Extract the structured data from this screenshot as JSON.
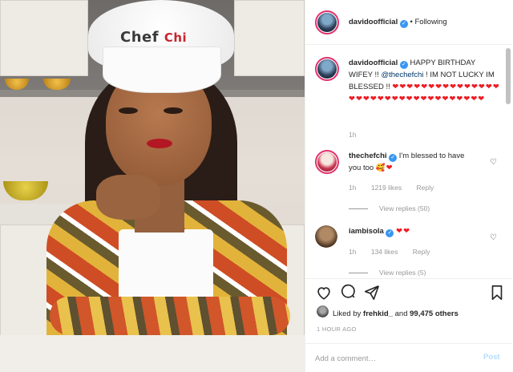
{
  "post": {
    "author": "davidoofficial",
    "follow_status": "Following",
    "separator": "•"
  },
  "caption": {
    "username": "davidoofficial",
    "text_before": "HAPPY BIRTHDAY WIFEY !! ",
    "mention": "@thechefchi",
    "text_after": " ! IM NOT LUCKY IM BLESSED !! ",
    "hearts": "❤❤❤❤❤❤❤❤❤❤❤❤❤❤❤❤❤❤❤❤❤❤❤❤❤❤❤❤❤❤❤❤❤❤",
    "age": "1h"
  },
  "comments": [
    {
      "username": "thechefchi",
      "text": "I'm blessed to have you too ",
      "emoji": "🥰❤",
      "age": "1h",
      "likes": "1219 likes",
      "reply": "Reply",
      "view_replies": "View replies (50)"
    },
    {
      "username": "iambisola",
      "text": "",
      "emoji": "❤❤",
      "age": "1h",
      "likes": "134 likes",
      "reply": "Reply",
      "view_replies": "View replies (5)"
    }
  ],
  "photo": {
    "hat_text_main": "Chef",
    "hat_text_accent": "Chi"
  },
  "engagement": {
    "liked_prefix": "Liked by ",
    "liked_user": "frehkid_",
    "liked_suffix": " and ",
    "others": "99,475 others",
    "timestamp": "1 HOUR AGO"
  },
  "composer": {
    "placeholder": "Add a comment…",
    "post_label": "Post"
  },
  "colors": {
    "verified": "#3897f0",
    "heart": "#ed1c24",
    "post_disabled": "#b3dbff",
    "story_ring": "#e1306c"
  },
  "icons": [
    "verified-badge-icon",
    "heart-outline-icon",
    "comment-icon",
    "share-icon",
    "bookmark-icon",
    "more-options-icon"
  ]
}
